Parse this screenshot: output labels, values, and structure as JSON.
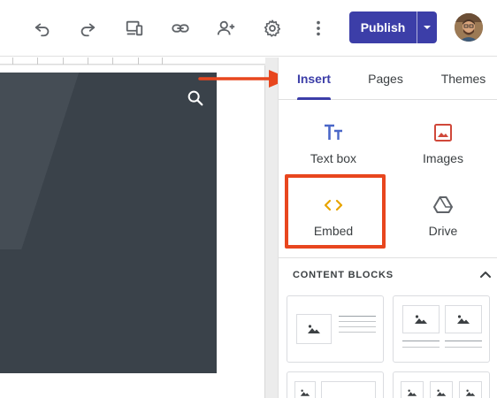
{
  "toolbar": {
    "icons": [
      "undo-icon",
      "redo-icon",
      "preview-devices-icon",
      "link-icon",
      "share-add-person-icon",
      "settings-gear-icon",
      "more-vertical-icon"
    ],
    "publish_label": "Publish"
  },
  "tabs": [
    {
      "label": "Insert",
      "active": true
    },
    {
      "label": "Pages",
      "active": false
    },
    {
      "label": "Themes",
      "active": false
    }
  ],
  "insert_tools": [
    {
      "label": "Text box",
      "icon": "text-box-icon",
      "color": "#4a67c8"
    },
    {
      "label": "Images",
      "icon": "image-icon",
      "color": "#d0483a"
    },
    {
      "label": "Embed",
      "icon": "embed-code-icon",
      "color": "#e8a400"
    },
    {
      "label": "Drive",
      "icon": "drive-icon",
      "color": "#5f6368"
    }
  ],
  "content_blocks": {
    "title": "CONTENT BLOCKS"
  },
  "colors": {
    "accent": "#3c3ea8",
    "highlight": "#e8461e",
    "hero": "#3a424a"
  }
}
